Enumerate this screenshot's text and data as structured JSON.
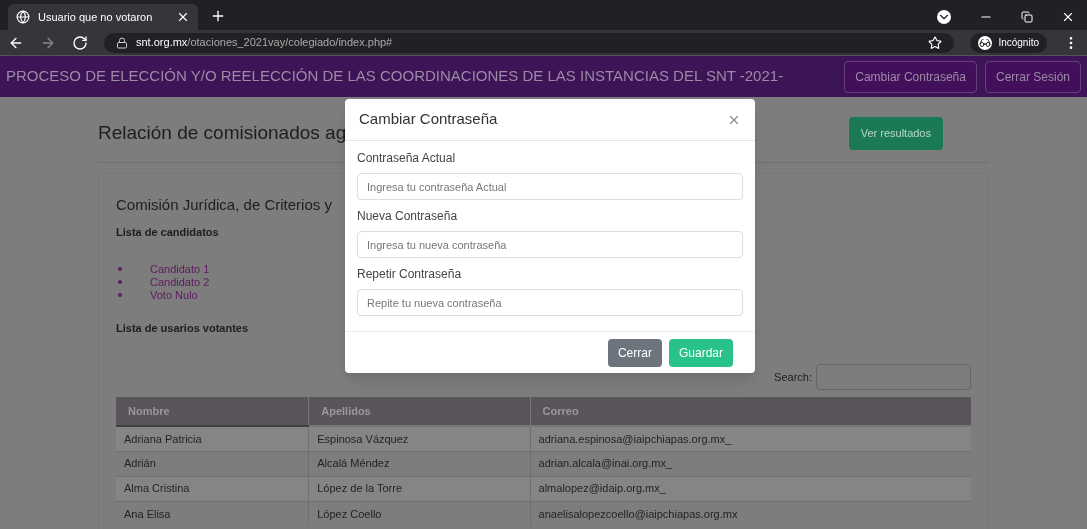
{
  "browser": {
    "tab_title": "Usuario que no votaron",
    "url_host": "snt.org.mx",
    "url_path": "/otaciones_2021vay/colegiado/index.php#",
    "profile": "Incógnito"
  },
  "navbar": {
    "title": "PROCESO DE ELECCIÓN Y/O REELECCIÓN DE LAS COORDINACIONES DE LAS INSTANCIAS DEL SNT -2021-",
    "buttons": [
      "Cambiar Contraseña",
      "Cerrar Sesión"
    ]
  },
  "page": {
    "heading": "Relación de comisionados ag",
    "results_button": "Ver resultados",
    "card": {
      "title": "Comisión Jurídica, de Criterios y",
      "candidates_heading": "Lista de candidatos",
      "candidates": [
        "Candidato 1",
        "Candidato 2",
        "Voto Nulo"
      ],
      "voters_heading": "Lista de usarios votantes",
      "search_label": "Search:",
      "table": {
        "columns": [
          "Nombre",
          "Apellidos",
          "Correo"
        ],
        "rows": [
          [
            "Adriana Patricia",
            "Espinosa Vázquez",
            "adriana.espinosa@iaipchiapas.org.mx_"
          ],
          [
            "Adrián",
            "Alcalá Méndez",
            "adrian.alcala@inai.org.mx_"
          ],
          [
            "Alma Cristina",
            "López de la Torre",
            "almalopez@idaip.org.mx_"
          ],
          [
            "Ana Elisa",
            "López Coello",
            "anaelisalopezcoello@iaipchiapas.org.mx"
          ]
        ]
      }
    }
  },
  "modal": {
    "title": "Cambiar Contraseña",
    "fields": [
      {
        "label": "Contraseña Actual",
        "placeholder": "Ingresa tu contraseña Actual"
      },
      {
        "label": "Nueva Contraseña",
        "placeholder": "Ingresa tu nueva contraseña"
      },
      {
        "label": "Repetir Contraseña",
        "placeholder": "Repite tu nueva contraseña"
      }
    ],
    "buttons": [
      {
        "label": "Cerrar",
        "kind": "secondary"
      },
      {
        "label": "Guardar",
        "kind": "primary"
      }
    ]
  }
}
